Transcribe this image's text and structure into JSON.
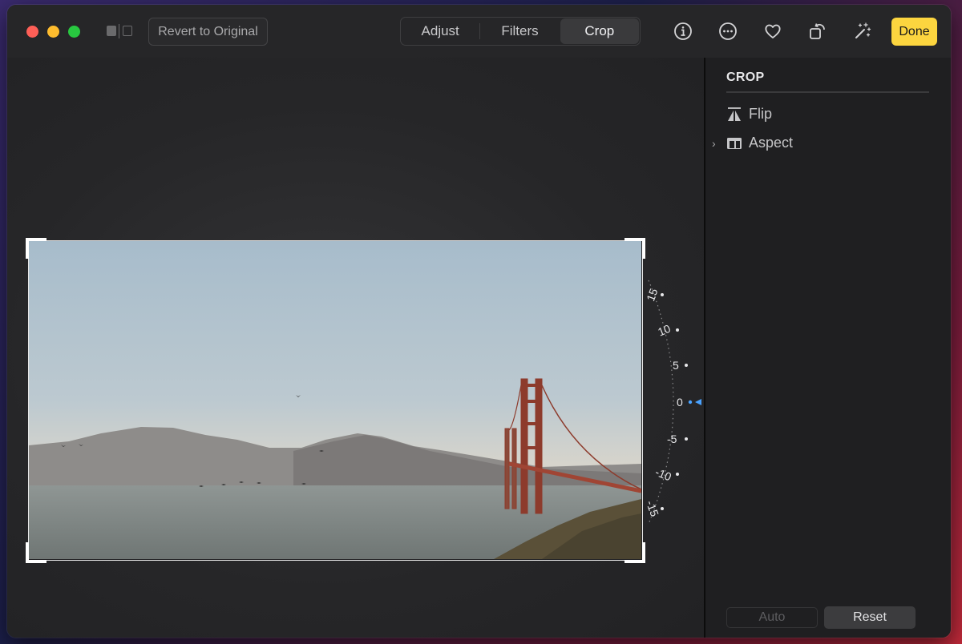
{
  "toolbar": {
    "revert_label": "Revert to Original",
    "tabs": [
      {
        "label": "Adjust",
        "active": false
      },
      {
        "label": "Filters",
        "active": false
      },
      {
        "label": "Crop",
        "active": true
      }
    ],
    "done_label": "Done",
    "accent_color": "#fcd53f",
    "icons": [
      "info-icon",
      "more-icon",
      "favorite-heart-icon",
      "rotate-icon",
      "auto-enhance-wand-icon"
    ]
  },
  "dial": {
    "ticks": [
      "15",
      "10",
      "5",
      "0",
      "-5",
      "-10",
      "-15"
    ],
    "current_value": "0",
    "indicator_color": "#4aa3ff"
  },
  "sidebar": {
    "title": "CROP",
    "items": [
      {
        "label": "Flip",
        "icon": "flip-icon"
      },
      {
        "label": "Aspect",
        "icon": "aspect-icon",
        "expandable": true
      }
    ],
    "auto_label": "Auto",
    "reset_label": "Reset"
  }
}
